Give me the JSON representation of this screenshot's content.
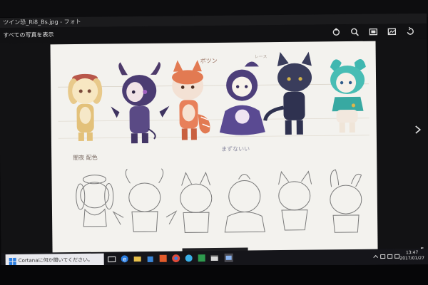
{
  "window": {
    "title": "ツイン恐_Ri8_Bs.jpg - フォト",
    "back_link": "すべての写真を表示"
  },
  "toolbar": {
    "icons": [
      "share-icon",
      "zoom-icon",
      "slideshow-icon",
      "edit-icon",
      "rotate-icon"
    ]
  },
  "image": {
    "annotations": {
      "top_label": "ボツン",
      "small_label": "レース",
      "left_label": "闇夜 配色",
      "bottom_label": "まずないい"
    }
  },
  "nav_bar": {
    "icons": [
      "previous-icon",
      "info-icon",
      "delete-icon",
      "next-icon"
    ]
  },
  "taskbar": {
    "search_placeholder": "Cortanaに何か聞いてください。",
    "apps": [
      "task-view-icon",
      "edge-icon",
      "file-explorer-icon",
      "store-icon",
      "media-icon",
      "chrome-icon",
      "ie-icon",
      "excel-icon",
      "film-icon",
      "photos-icon"
    ],
    "time": "13:47",
    "date": "2017/01/27"
  },
  "colors": {
    "image_background": "#f3f2ee",
    "titlebar": "#1b1b1d",
    "taskbar": "#15151a",
    "accent": "#2a7de1"
  }
}
